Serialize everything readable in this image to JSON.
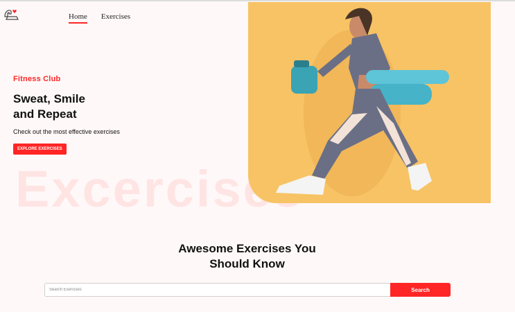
{
  "nav": {
    "items": [
      {
        "label": "Home",
        "active": true
      },
      {
        "label": "Exercises",
        "active": false
      }
    ]
  },
  "hero": {
    "brand": "Fitness Club",
    "headline": "Sweat, Smile\nand Repeat",
    "subline": "Check out the most effective exercises",
    "cta_label": "EXPLORE EXERCISES",
    "background_word": "Excercises",
    "image_background": "#f7c365"
  },
  "section": {
    "title": "Awesome Exercises You\nShould Know"
  },
  "search": {
    "placeholder": "Search Exercises",
    "value": "",
    "button_label": "Search"
  },
  "colors": {
    "accent": "#ff2625",
    "page_background": "#fff8f8"
  }
}
